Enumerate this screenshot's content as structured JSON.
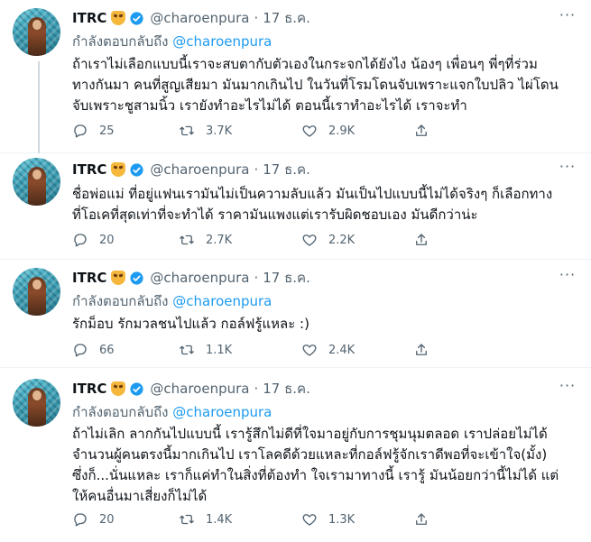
{
  "tweets": [
    {
      "name": "ITRC",
      "handle": "@charoenpura",
      "dot": "·",
      "time": "17 ธ.ค.",
      "reply_prefix": "กำลังตอบกลับถึง",
      "reply_to": "@charoenpura",
      "lines": [
        "ถ้าเราไม่เลือกแบบนี้เราจะสบตากับตัวเองในกระจกได้ยังไง น้องๆ เพื่อนๆ พี่ๆที่ร่วม",
        "ทางกันมา คนที่สูญเสียมา มันมากเกินไป ในวันที่โรมโดนจับเพราะแจกใบปลิว ไผ่โดน",
        "จับเพราะชูสามนิ้ว เรายังทำอะไรไม่ได้ ตอนนี้เราทำอะไรได้ เราจะทำ"
      ],
      "replies": "25",
      "retweets": "3.7K",
      "likes": "2.9K"
    },
    {
      "name": "ITRC",
      "handle": "@charoenpura",
      "dot": "·",
      "time": "17 ธ.ค.",
      "reply_prefix": "",
      "reply_to": "",
      "lines": [
        "ชื่อพ่อแม่ ที่อยู่แฟนเรามันไม่เป็นความลับแล้ว มันเป็นไปแบบนี้ไม่ได้จริงๆ ก็เลือกทาง",
        "ที่โอเคที่สุดเท่าที่จะทำได้ ราคามันแพงแต่เรารับผิดชอบเอง มันดีกว่าน่ะ"
      ],
      "replies": "20",
      "retweets": "2.7K",
      "likes": "2.2K"
    },
    {
      "name": "ITRC",
      "handle": "@charoenpura",
      "dot": "·",
      "time": "17 ธ.ค.",
      "reply_prefix": "กำลังตอบกลับถึง",
      "reply_to": "@charoenpura",
      "lines": [
        "รักม็อบ รักมวลชนไปแล้ว กอล์ฟรู้แหละ :)"
      ],
      "replies": "66",
      "retweets": "1.1K",
      "likes": "2.4K"
    },
    {
      "name": "ITRC",
      "handle": "@charoenpura",
      "dot": "·",
      "time": "17 ธ.ค.",
      "reply_prefix": "กำลังตอบกลับถึง",
      "reply_to": "@charoenpura",
      "lines": [
        "ถ้าไม่เลิก ลากกันไปแบบนี้ เรารู้สึกไม่ดีที่ใจมาอยู่กับการชุมนุมตลอด เราปล่อยไม่ได้",
        "จำนวนผู้คนตรงนี้มากเกินไป เราโลคดีด้วยแหละที่กอล์ฟรู้จักเราดีพอที่จะเข้าใจ(มั้ง)",
        "ซึ่งก็...นั่นแหละ เราก็แค่ทำในสิ่งที่ต้องทำ ใจเรามาทางนี้ เรารู้ มันน้อยกว่านี้ไม่ได้ แต่",
        "ให้คนอื่นมาเสี่ยงก็ไม่ได้"
      ],
      "replies": "20",
      "retweets": "1.4K",
      "likes": "1.3K"
    }
  ],
  "colors": {
    "accent": "#1d9bf0",
    "secondary_text": "#536471",
    "thread_line": "#cfd9de",
    "divider": "#eff3f4"
  },
  "icons": {
    "reply": "speech-bubble-icon",
    "retweet": "retweet-arrows-icon",
    "like": "heart-icon",
    "share": "share-upload-icon",
    "more": "more-dots-icon",
    "verified": "verified-badge-icon",
    "emoji": "devil-smirk-emoji"
  }
}
